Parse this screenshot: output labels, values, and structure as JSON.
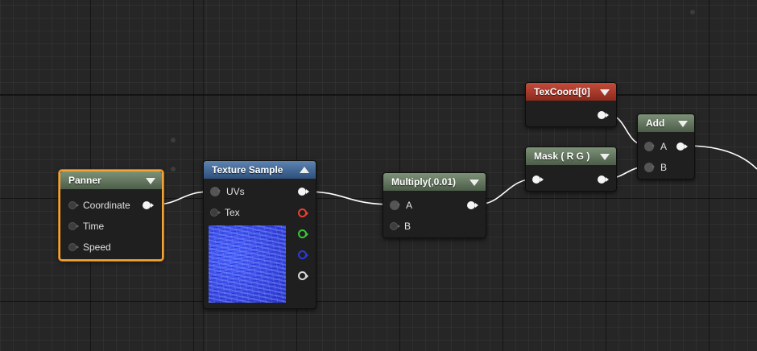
{
  "nodes": {
    "panner": {
      "title": "Panner",
      "inputs": [
        "Coordinate",
        "Time",
        "Speed"
      ]
    },
    "texture_sample": {
      "title": "Texture Sample",
      "inputs": [
        "UVs",
        "Tex"
      ],
      "outputs": [
        "rgb",
        "r",
        "g",
        "b",
        "a"
      ],
      "output_colors": {
        "r": "#e64030",
        "g": "#3cc33c",
        "b": "#2a3adf",
        "a": "#d8d8d8"
      }
    },
    "multiply": {
      "title": "Multiply(,0.01)",
      "inputs": [
        "A",
        "B"
      ]
    },
    "mask": {
      "title": "Mask ( R G )"
    },
    "texcoord": {
      "title": "TexCoord[0]"
    },
    "add": {
      "title": "Add",
      "inputs": [
        "A",
        "B"
      ]
    }
  },
  "colors": {
    "selection": "#f2a43a",
    "header_green": "#5f735b",
    "header_blue": "#3a6494",
    "header_red": "#a83a2b",
    "wire": "#ffffff"
  }
}
